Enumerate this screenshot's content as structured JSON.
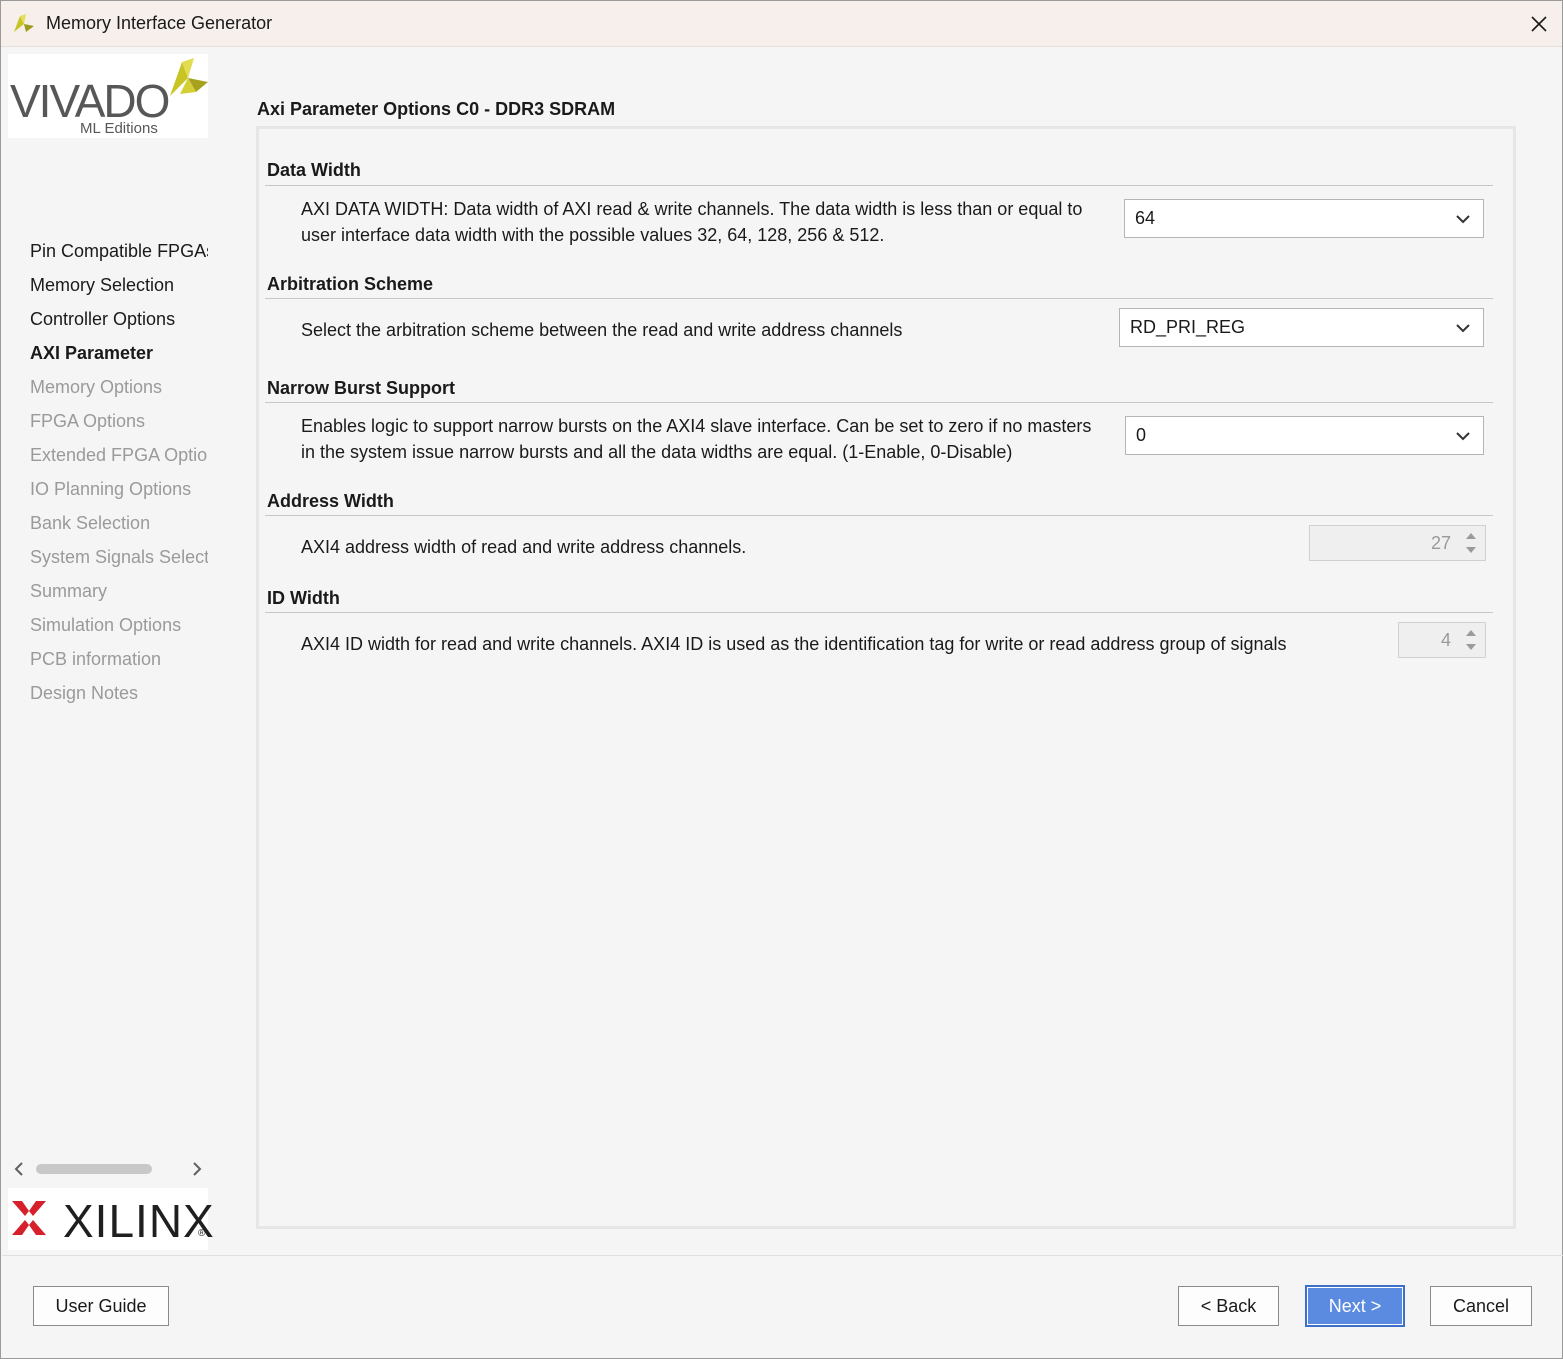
{
  "window": {
    "title": "Memory Interface Generator",
    "app_icon": "vivado-icon",
    "close_icon": "close-icon"
  },
  "branding": {
    "vivado_word": "VIVADO",
    "vivado_sub": "ML Editions",
    "xilinx_word": "XILINX",
    "xilinx_reg": "®"
  },
  "sidebar": {
    "items": [
      {
        "label": "Pin Compatible FPGAs",
        "state": "done"
      },
      {
        "label": "Memory Selection",
        "state": "done"
      },
      {
        "label": "Controller Options",
        "state": "done"
      },
      {
        "label": "AXI Parameter",
        "state": "active"
      },
      {
        "label": "Memory Options",
        "state": "pending"
      },
      {
        "label": "FPGA Options",
        "state": "pending"
      },
      {
        "label": "Extended FPGA Options",
        "state": "pending"
      },
      {
        "label": "IO Planning Options",
        "state": "pending"
      },
      {
        "label": "Bank Selection",
        "state": "pending"
      },
      {
        "label": "System Signals Selection",
        "state": "pending"
      },
      {
        "label": "Summary",
        "state": "pending"
      },
      {
        "label": "Simulation Options",
        "state": "pending"
      },
      {
        "label": "PCB information",
        "state": "pending"
      },
      {
        "label": "Design Notes",
        "state": "pending"
      }
    ]
  },
  "main": {
    "page_title": "Axi Parameter Options C0 - DDR3 SDRAM",
    "data_width": {
      "title": "Data Width",
      "desc_line1": "AXI DATA WIDTH: Data width of AXI read & write channels. The data width is less than or equal to",
      "desc_line2": "user interface data width with the possible values 32, 64, 128, 256 & 512.",
      "value": "64"
    },
    "arbitration": {
      "title": "Arbitration Scheme",
      "desc": "Select the arbitration scheme between the read and write address channels",
      "value": "RD_PRI_REG"
    },
    "narrow_burst": {
      "title": "Narrow Burst Support",
      "desc_line1": "Enables logic to support narrow bursts on the AXI4 slave interface. Can be set to zero if no masters",
      "desc_line2": "in the system issue narrow bursts and all the data widths are equal. (1-Enable, 0-Disable)",
      "value": "0"
    },
    "address_width": {
      "title": "Address Width",
      "desc": "AXI4 address width of read and write address channels.",
      "value": "27"
    },
    "id_width": {
      "title": "ID Width",
      "desc": "AXI4 ID width for read and write channels. AXI4 ID is used as the identification tag for write or read address group of signals",
      "value": "4"
    }
  },
  "footer": {
    "user_guide_label": "User Guide",
    "back_label": "< Back",
    "next_label": "Next >",
    "cancel_label": "Cancel"
  },
  "colors": {
    "titlebar_bg": "#f7efec",
    "panel_bg": "#f5f5f5",
    "primary_button": "#5b8be0",
    "vivado_mark": "#c9c425",
    "xilinx_mark": "#d6202c"
  }
}
